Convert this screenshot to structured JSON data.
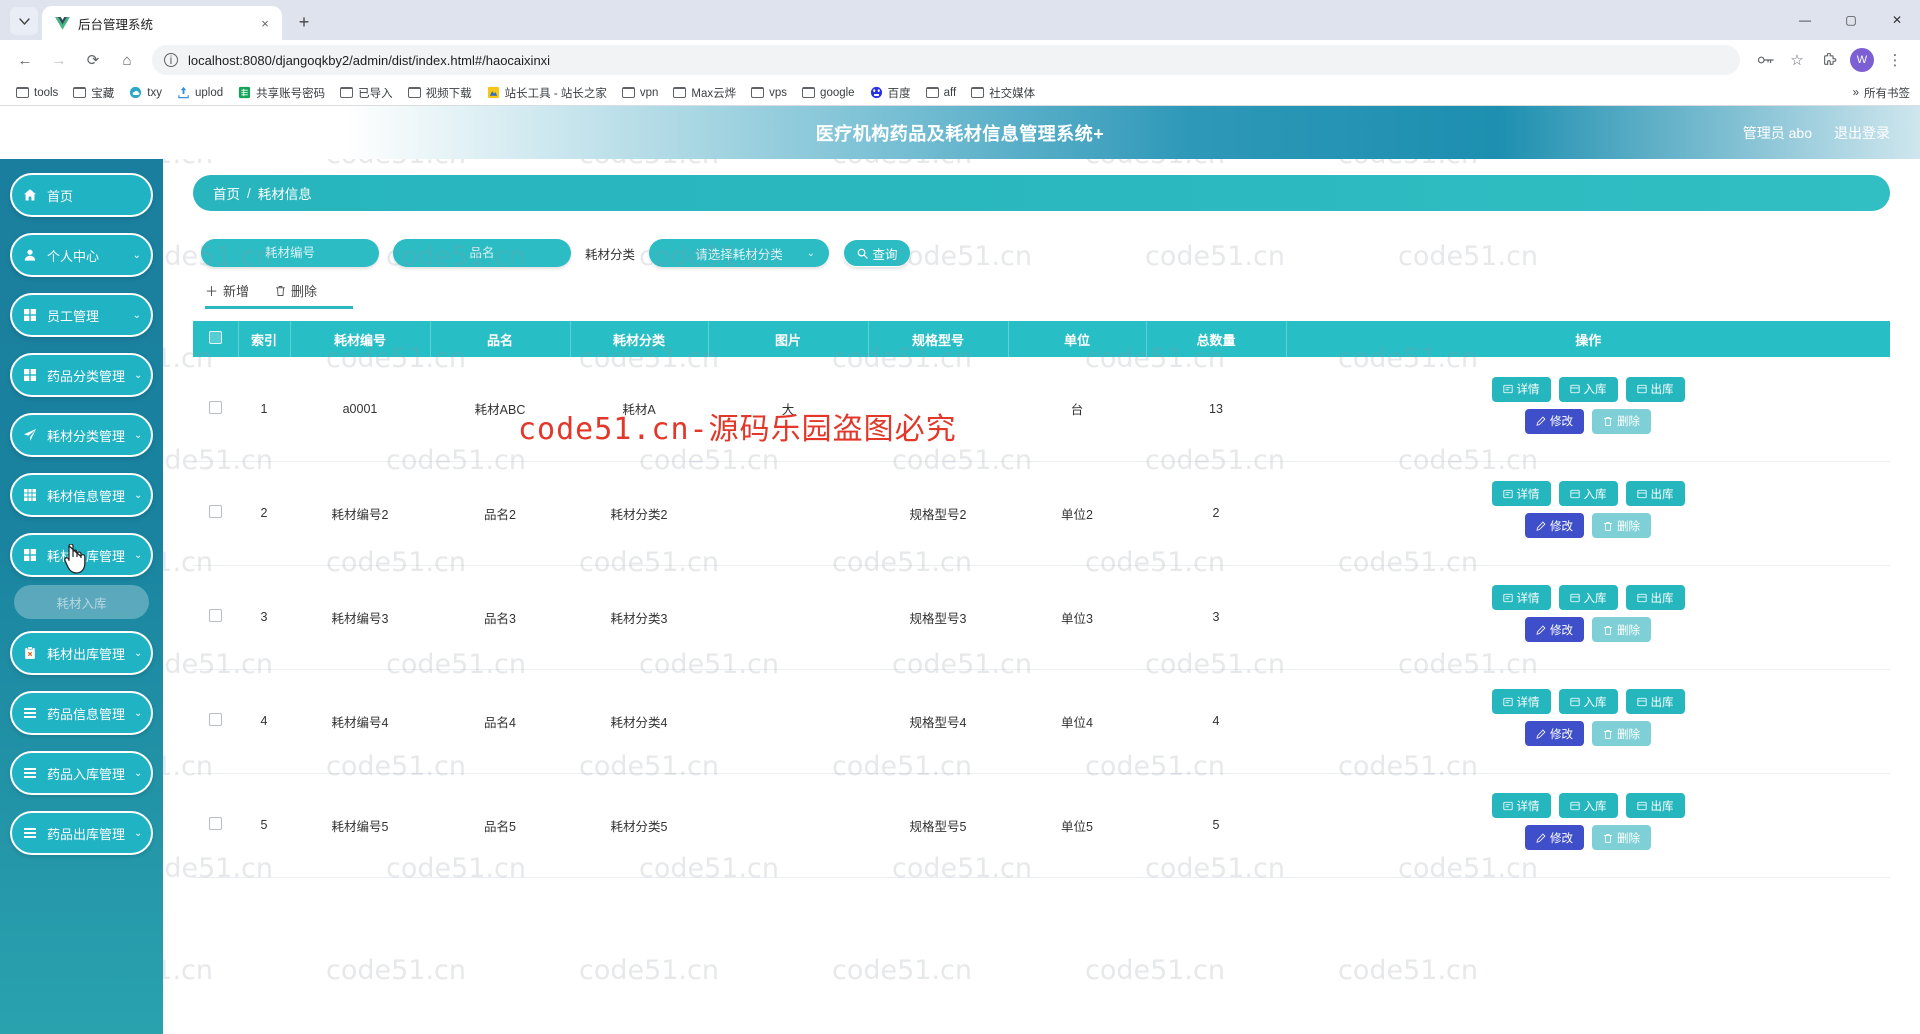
{
  "browser": {
    "tab": {
      "title": "后台管理系统",
      "favicon": "vue-logo-icon",
      "close": "×"
    },
    "new_tab": "+",
    "window_controls": {
      "minimize": "—",
      "maximize": "▢",
      "close": "✕"
    },
    "nav": {
      "back": "←",
      "forward": "→",
      "reload": "⟳",
      "home": "⌂"
    },
    "url": "localhost:8080/djangoqkby2/admin/dist/index.html#/haocaixinxi",
    "omnibox_right": {
      "key_icon": "password-key-icon",
      "star": "☆",
      "extensions": "puzzle-icon",
      "profile": "W",
      "menu": "⋮"
    },
    "bookmarks": [
      {
        "label": "tools",
        "icon": "folder-icon"
      },
      {
        "label": "宝藏",
        "icon": "folder-icon"
      },
      {
        "label": "txy",
        "icon": "cloud-icon"
      },
      {
        "label": "uplod",
        "icon": "upload-icon"
      },
      {
        "label": "共享账号密码",
        "icon": "sheet-icon"
      },
      {
        "label": "已导入",
        "icon": "folder-icon"
      },
      {
        "label": "视频下载",
        "icon": "folder-icon"
      },
      {
        "label": "站长工具 - 站长之家",
        "icon": "chinaz-icon"
      },
      {
        "label": "vpn",
        "icon": "folder-icon"
      },
      {
        "label": "Max云烨",
        "icon": "folder-icon"
      },
      {
        "label": "vps",
        "icon": "folder-icon"
      },
      {
        "label": "google",
        "icon": "folder-icon"
      },
      {
        "label": "百度",
        "icon": "baidu-icon"
      },
      {
        "label": "aff",
        "icon": "folder-icon"
      },
      {
        "label": "社交媒体",
        "icon": "folder-icon"
      }
    ],
    "bookmarks_all": "所有书签"
  },
  "app": {
    "title": "医疗机构药品及耗材信息管理系统+",
    "admin_label": "管理员 abo",
    "logout_label": "退出登录",
    "breadcrumb": {
      "root": "首页",
      "sep": "/",
      "current": "耗材信息"
    }
  },
  "sidebar": {
    "items": [
      {
        "label": "首页",
        "icon": "home-icon",
        "caret": ""
      },
      {
        "label": "个人中心",
        "icon": "user-icon",
        "caret": "⌄"
      },
      {
        "label": "员工管理",
        "icon": "grid-icon",
        "caret": "⌄"
      },
      {
        "label": "药品分类管理",
        "icon": "grid-icon",
        "caret": "⌄"
      },
      {
        "label": "耗材分类管理",
        "icon": "send-icon",
        "caret": "⌄"
      },
      {
        "label": "耗材信息管理",
        "icon": "table-icon",
        "caret": "⌄"
      },
      {
        "label": "耗材入库管理",
        "icon": "grid-icon",
        "caret": "⌄"
      },
      {
        "label": "耗材出库管理",
        "icon": "clipboard-icon",
        "caret": "⌄"
      },
      {
        "label": "药品信息管理",
        "icon": "list-icon",
        "caret": "⌄"
      },
      {
        "label": "药品入库管理",
        "icon": "list-icon",
        "caret": "⌄"
      },
      {
        "label": "药品出库管理",
        "icon": "list-icon",
        "caret": "⌄"
      }
    ],
    "submenu": {
      "label": "耗材入库",
      "parent_index": 6
    }
  },
  "filters": {
    "code_placeholder": "耗材编号",
    "code_value": "",
    "name_placeholder": "品名",
    "name_value": "",
    "category_label": "耗材分类",
    "category_value": "请选择耗材分类",
    "category_caret": "⌄",
    "query_label": "查询",
    "query_icon": "search-icon"
  },
  "toolbar": {
    "add_label": "新增",
    "add_icon": "plus-icon",
    "delete_label": "删除",
    "delete_icon": "trash-icon"
  },
  "table": {
    "columns": [
      "索引",
      "耗材编号",
      "品名",
      "耗材分类",
      "图片",
      "规格型号",
      "单位",
      "总数量",
      "操作"
    ],
    "select_all": false,
    "rows": [
      {
        "checked": false,
        "index": "1",
        "code": "a0001",
        "name": "耗材ABC",
        "category": "耗材A",
        "image": "大",
        "spec": "",
        "unit": "台",
        "total": "13"
      },
      {
        "checked": false,
        "index": "2",
        "code": "耗材编号2",
        "name": "品名2",
        "category": "耗材分类2",
        "image": "",
        "spec": "规格型号2",
        "unit": "单位2",
        "total": "2"
      },
      {
        "checked": false,
        "index": "3",
        "code": "耗材编号3",
        "name": "品名3",
        "category": "耗材分类3",
        "image": "",
        "spec": "规格型号3",
        "unit": "单位3",
        "total": "3"
      },
      {
        "checked": false,
        "index": "4",
        "code": "耗材编号4",
        "name": "品名4",
        "category": "耗材分类4",
        "image": "",
        "spec": "规格型号4",
        "unit": "单位4",
        "total": "4"
      },
      {
        "checked": false,
        "index": "5",
        "code": "耗材编号5",
        "name": "品名5",
        "category": "耗材分类5",
        "image": "",
        "spec": "规格型号5",
        "unit": "单位5",
        "total": "5"
      }
    ],
    "actions": {
      "detail": "详情",
      "stock_in": "入库",
      "stock_out": "出库",
      "edit": "修改",
      "delete": "删除"
    }
  },
  "watermark": {
    "tile": "code51.cn",
    "banner": "code51.cn-源码乐园盗图必究"
  },
  "colors": {
    "accent": "#28bec6",
    "sidebar_top": "#1a7f9e",
    "sidebar_bottom": "#2aa2ae",
    "edit_button": "#3f4ec9",
    "delete_button": "#7fd0d6",
    "watermark_red": "#e2372a"
  }
}
